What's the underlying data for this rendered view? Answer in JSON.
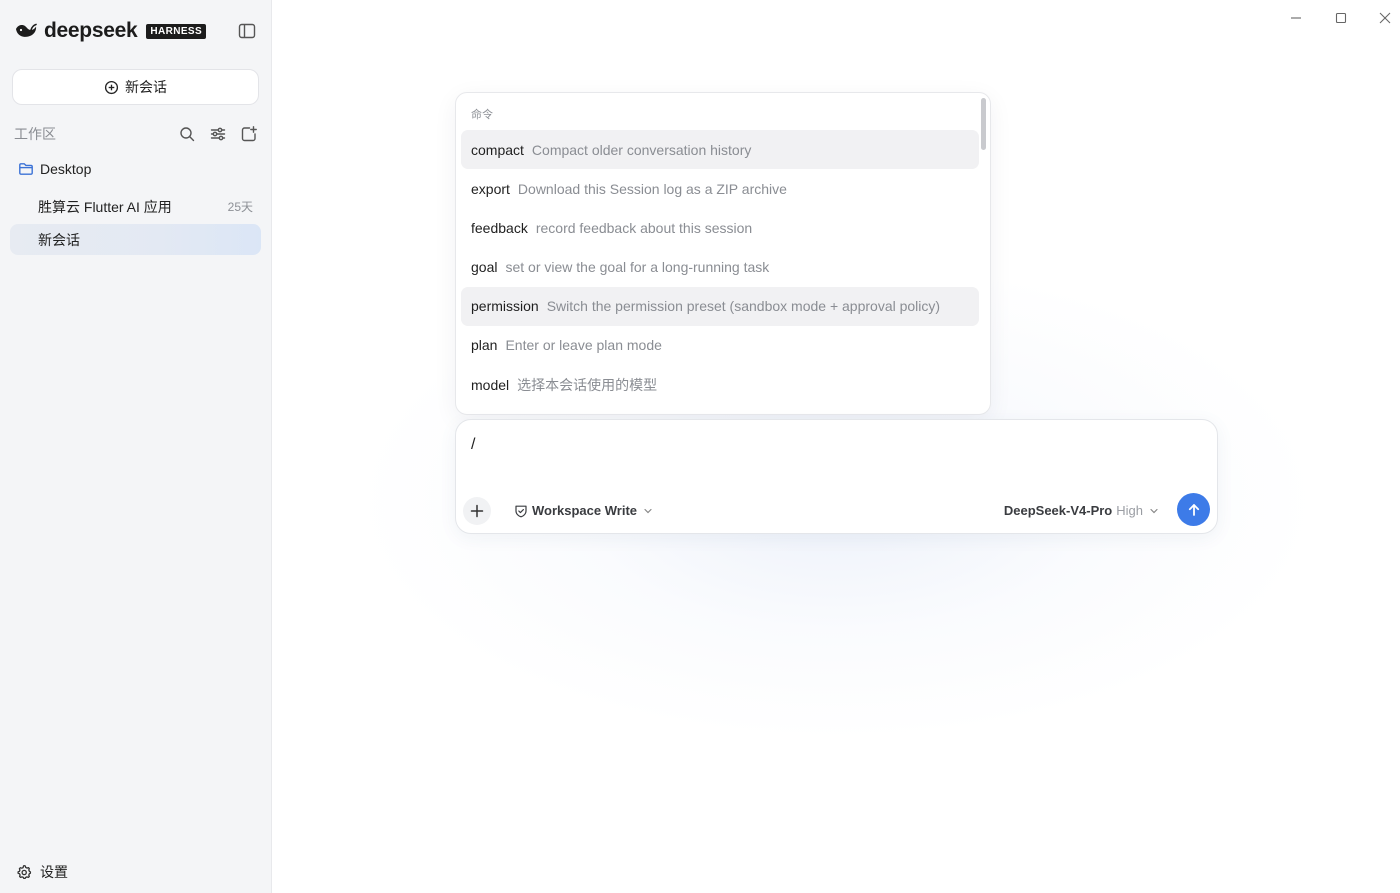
{
  "brand": {
    "name": "deepseek",
    "badge": "HARNESS"
  },
  "sidebar": {
    "new_chat_label": "新会话",
    "workspace_label": "工作区",
    "folder": {
      "name": "Desktop"
    },
    "sessions": [
      {
        "title": "胜算云 Flutter AI 应用",
        "age": "25天",
        "active": false
      },
      {
        "title": "新会话",
        "age": "",
        "active": true
      }
    ],
    "settings_label": "设置"
  },
  "command_popup": {
    "heading": "命令",
    "items": [
      {
        "name": "compact",
        "description": "Compact older conversation history",
        "highlighted": true
      },
      {
        "name": "export",
        "description": "Download this Session log as a ZIP archive",
        "highlighted": false
      },
      {
        "name": "feedback",
        "description": "record feedback about this session",
        "highlighted": false
      },
      {
        "name": "goal",
        "description": "set or view the goal for a long-running task",
        "highlighted": false
      },
      {
        "name": "permission",
        "description": "Switch the permission preset (sandbox mode + approval policy)",
        "highlighted": true
      },
      {
        "name": "plan",
        "description": "Enter or leave plan mode",
        "highlighted": false
      },
      {
        "name": "model",
        "description": "选择本会话使用的模型",
        "highlighted": false
      }
    ]
  },
  "composer": {
    "input_value": "/",
    "permission_mode": "Workspace Write",
    "model_name": "DeepSeek-V4-Pro",
    "model_effort": "High"
  },
  "icons": {
    "brand_logo": "whale-icon",
    "sidebar_toggle": "sidebar-panel-icon",
    "new_chat": "plus-circle-icon",
    "search": "search-icon",
    "filter": "sliders-icon",
    "new_folder": "new-workspace-icon",
    "folder": "folder-icon",
    "settings": "gear-icon",
    "attach": "plus-icon",
    "permission": "shield-icon",
    "send": "arrow-up-icon"
  },
  "colors": {
    "accent": "#3d7be8",
    "folder": "#3b72d6",
    "sidebar_bg": "#f4f5f7",
    "active_session_bg": "#e3e9f3"
  }
}
